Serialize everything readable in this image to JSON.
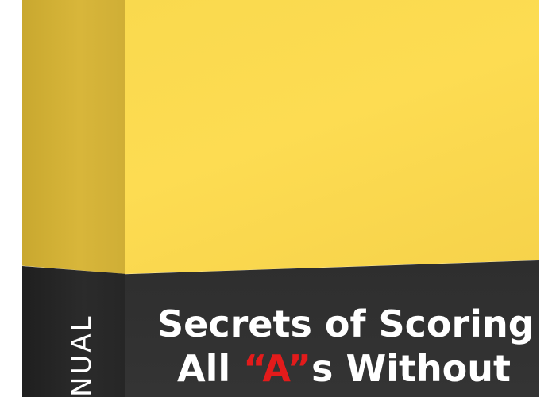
{
  "box": {
    "spine_label": "NUAL",
    "title_line1": "Secrets of Scoring",
    "title_line2_prefix": "All ",
    "title_line2_accent": "“A”",
    "title_line2_suffix": "s Without"
  },
  "colors": {
    "yellow": "#fddc52",
    "dark": "#2e2e2e",
    "accent_red": "#e31b1b",
    "text": "#ffffff"
  }
}
